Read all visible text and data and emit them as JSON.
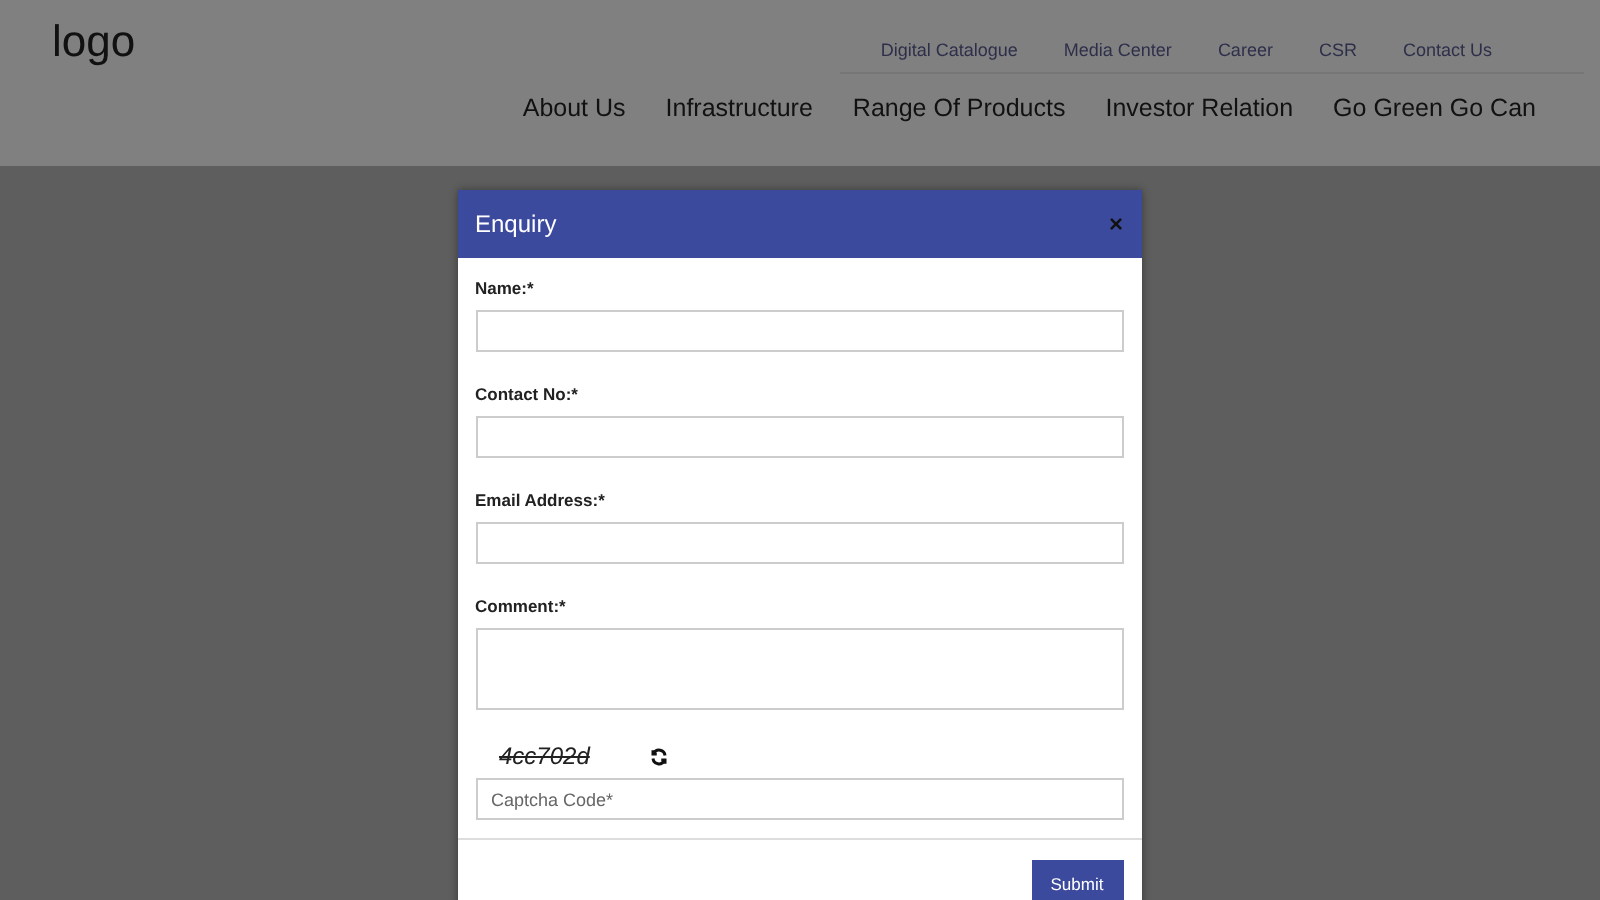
{
  "header": {
    "logo": "logo",
    "top_links": [
      "Digital Catalogue",
      "Media Center",
      "Career",
      "CSR",
      "Contact Us"
    ],
    "main_nav": [
      "About Us",
      "Infrastructure",
      "Range Of Products",
      "Investor Relation",
      "Go Green Go Can"
    ]
  },
  "modal": {
    "title": "Enquiry",
    "close": "×",
    "fields": [
      {
        "label": "Name:*",
        "kind": "text"
      },
      {
        "label": "Contact No:*",
        "kind": "text"
      },
      {
        "label": "Email Address:*",
        "kind": "text"
      },
      {
        "label": "Comment:*",
        "kind": "textarea"
      }
    ],
    "captcha": {
      "code": "4cc702d",
      "placeholder": "Captcha Code*"
    },
    "submit": "Submit"
  }
}
